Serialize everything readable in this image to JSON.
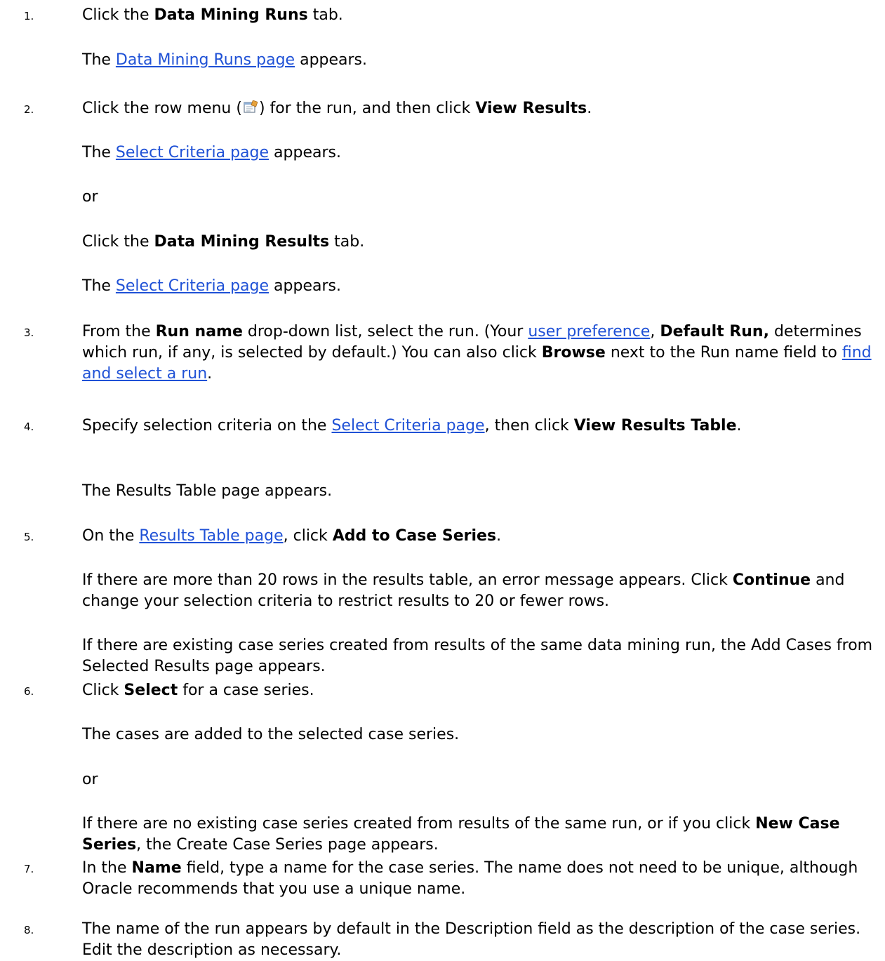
{
  "steps": [
    {
      "num": "1.",
      "paras": [
        {
          "t1": "Click the ",
          "b1": "Data Mining Runs",
          "t2": " tab."
        },
        {
          "t1": "The ",
          "link": "Data Mining Runs page",
          "t2": " appears."
        }
      ]
    },
    {
      "num": "2.",
      "paras": [
        {
          "t1": "Click the row menu (",
          "icon": "row-menu-icon",
          "t2": ") for the run, and then click ",
          "b1": "View Results",
          "t3": "."
        },
        {
          "t1": "The ",
          "link": "Select Criteria page",
          "t2": " appears."
        },
        {
          "t1": "or"
        },
        {
          "t1": "Click the ",
          "b1": "Data Mining Results",
          "t2": " tab."
        },
        {
          "t1": "The ",
          "link": "Select Criteria page",
          "t2": " appears."
        }
      ]
    },
    {
      "num": "3.",
      "paras": [
        {
          "t1": "From the ",
          "b1": "Run name",
          "t2": " drop-down list, select the run. (Your ",
          "link1": "user preference",
          "t3": ", ",
          "b2": "Default Run,",
          "t4": " determines which run, if any, is selected by default.) You can also click ",
          "b3": "Browse",
          "t5": " next to the Run name field to ",
          "link2": "find and select a run",
          "t6": "."
        }
      ]
    },
    {
      "num": "4.",
      "paras": [
        {
          "t1": "Specify selection criteria on the ",
          "link": "Select Criteria page",
          "t2": ", then click ",
          "b1": "View Results Table",
          "t3": "."
        },
        {
          "t1": "The Results Table page appears."
        }
      ]
    },
    {
      "num": "5.",
      "paras": [
        {
          "t1": "On the ",
          "link": "Results Table page",
          "t2": ", click ",
          "b1": "Add to Case Series",
          "t3": "."
        },
        {
          "t1": "If there are more than 20 rows in the results table, an error message appears. Click ",
          "b1": "Continue",
          "t2": " and change your selection criteria to restrict results to 20 or fewer rows."
        },
        {
          "t1": "If there are existing case series created from results of the same data mining run, the Add Cases from Selected Results page appears."
        }
      ]
    },
    {
      "num": "6.",
      "paras": [
        {
          "t1": "Click ",
          "b1": "Select",
          "t2": " for a case series."
        },
        {
          "t1": "The cases are added to the selected case series."
        },
        {
          "t1": "or"
        },
        {
          "t1": "If there are no existing case series created from results of the same run, or if you click ",
          "b1": "New Case Series",
          "t2": ", the Create Case Series page appears."
        }
      ]
    },
    {
      "num": "7.",
      "paras": [
        {
          "t1": "In the ",
          "b1": "Name",
          "t2": " field, type a name for the case series. The name does not need to be unique, although Oracle recommends that you use a unique name."
        }
      ]
    },
    {
      "num": "8.",
      "paras": [
        {
          "t1": "The name of the run appears by default in the Description field as the description of the case series. Edit the description as necessary."
        }
      ]
    }
  ]
}
